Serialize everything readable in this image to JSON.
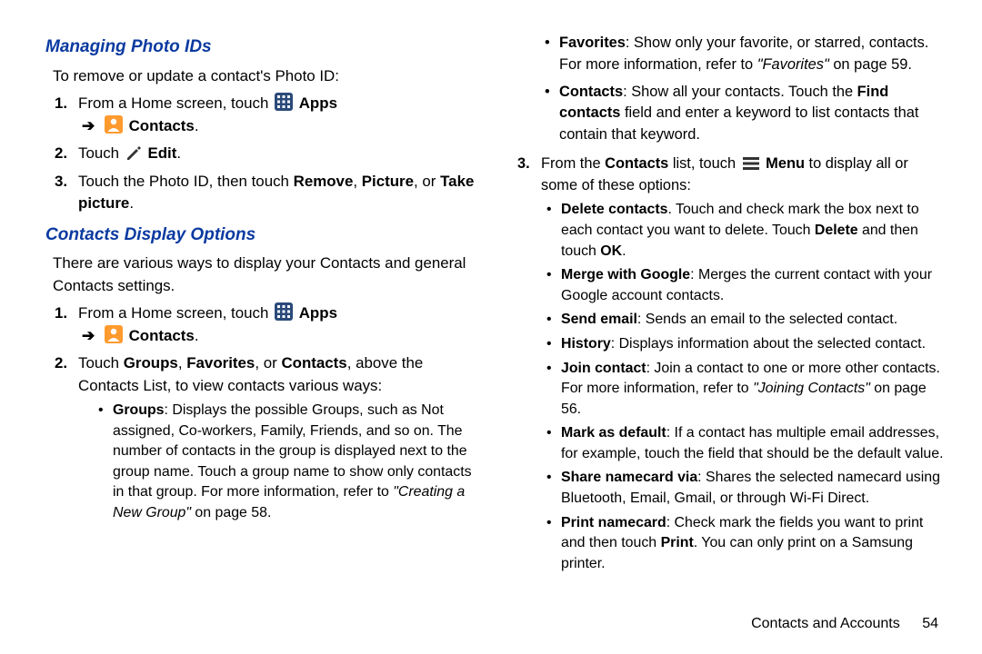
{
  "left": {
    "h1": "Managing Photo IDs",
    "intro1": "To remove or update a contact's Photo ID:",
    "s1a": "From a Home screen, touch ",
    "apps": "Apps",
    "contacts": "Contacts",
    "s2a": "Touch ",
    "edit": "Edit",
    "s3a": "Touch the Photo ID, then touch ",
    "remove": "Remove",
    "picture": "Picture",
    "or": ", or ",
    "takepic": "Take picture",
    "h2": "Contacts Display Options",
    "intro2": "There are various ways to display your Contacts and general Contacts settings.",
    "s1b": "From a Home screen, touch ",
    "s2b_a": "Touch ",
    "groups": "Groups",
    "favorites": "Favorites",
    "contacts_b": "Contacts",
    "s2b_b": ", above the Contacts List, to view contacts various ways:",
    "b_groups_a": ": Displays the possible Groups, such as Not assigned, Co-workers, Family, Friends, and so on. The number of contacts in the group is displayed next to the group name. Touch a group name to show only contacts in that group. For more information, refer to ",
    "ref_group": "\"Creating a New Group\"",
    "b_groups_b": " on page 58."
  },
  "right": {
    "b_fav_a": ": Show only your favorite, or starred, contacts. For more information, refer to ",
    "ref_fav": "\"Favorites\"",
    "b_fav_b": " on page 59.",
    "b_contacts_a": ": Show all your contacts. Touch the ",
    "findcontacts": "Find contacts",
    "b_contacts_b": " field and enter a keyword to list contacts that contain that keyword.",
    "s3r_a": "From the ",
    "contacts_list": "Contacts",
    "s3r_b": " list, touch ",
    "menu": "Menu",
    "s3r_c": " to display all or some of these options:",
    "del_t": "Delete contacts",
    "del_a": ". Touch and check mark the box next to each contact you want to delete. Touch ",
    "del_b": " and then touch ",
    "delete": "Delete",
    "ok": "OK",
    "merge_t": "Merge with Google",
    "merge_a": ": Merges the current contact with your Google account contacts.",
    "send_t": "Send email",
    "send_a": ": Sends an email to the selected contact.",
    "hist_t": "History",
    "hist_a": ": Displays information about the selected contact.",
    "join_t": "Join contact",
    "join_a": ": Join a contact to one or more other contacts. For more information, refer to ",
    "ref_join": "\"Joining Contacts\"",
    "join_b": " on page 56.",
    "mark_t": "Mark as default",
    "mark_a": ": If a contact has multiple email addresses, for example, touch the field that should be the default value.",
    "share_t": "Share namecard via",
    "share_a": ": Shares the selected namecard using Bluetooth, Email, Gmail, or through Wi-Fi Direct.",
    "print_t": "Print namecard",
    "print_a": ": Check mark the fields you want to print and then touch ",
    "print_b": ". You can only print on a Samsung printer.",
    "print_word": "Print"
  },
  "footer": {
    "section": "Contacts and Accounts",
    "page": "54"
  }
}
